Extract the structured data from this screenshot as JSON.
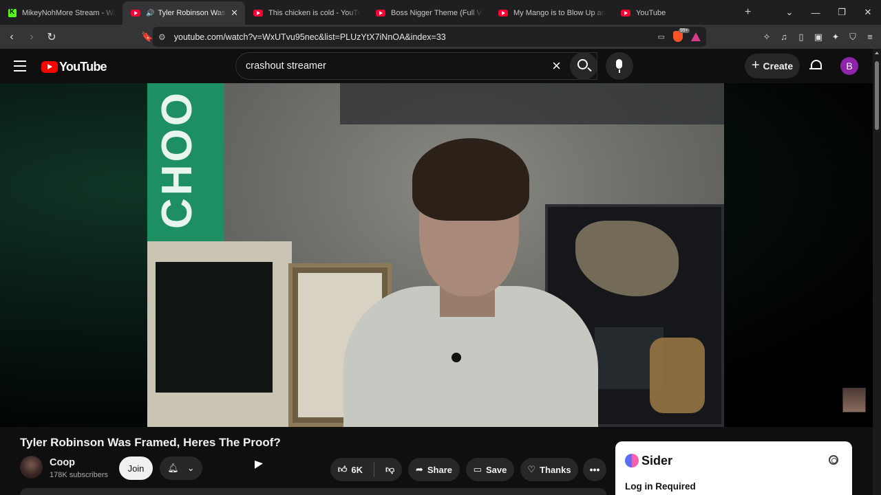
{
  "browser": {
    "tabs": [
      {
        "label": "MikeyNohMore Stream - Watch",
        "favicon": "kick-icon"
      },
      {
        "label": "Tyler Robinson Was Framed",
        "favicon": "youtube-icon",
        "active": true
      },
      {
        "label": "This chicken is cold - YouTube",
        "favicon": "youtube-icon"
      },
      {
        "label": "Boss Nigger Theme (Full Version",
        "favicon": "youtube-icon"
      },
      {
        "label": "My Mango is to Blow Up and T",
        "favicon": "youtube-icon"
      },
      {
        "label": "YouTube",
        "favicon": "youtube-icon"
      }
    ],
    "url": "youtube.com/watch?v=WxUTvu95nec&list=PLUzYtX7iNnOA&index=33",
    "brave_badge": "99+"
  },
  "youtube": {
    "logo_text": "YouTube",
    "search_query": "crashout streamer",
    "create_label": "Create",
    "avatar_letter": "B"
  },
  "video": {
    "title": "Tyler Robinson Was Framed, Heres The Proof?",
    "channel_name": "Coop",
    "subscribers": "178K subscribers",
    "join_label": "Join",
    "likes": "6K",
    "share_label": "Share",
    "save_label": "Save",
    "thanks_label": "Thanks",
    "banner_text": "CHOO"
  },
  "sider": {
    "name": "Sider",
    "status": "Log in Required"
  }
}
